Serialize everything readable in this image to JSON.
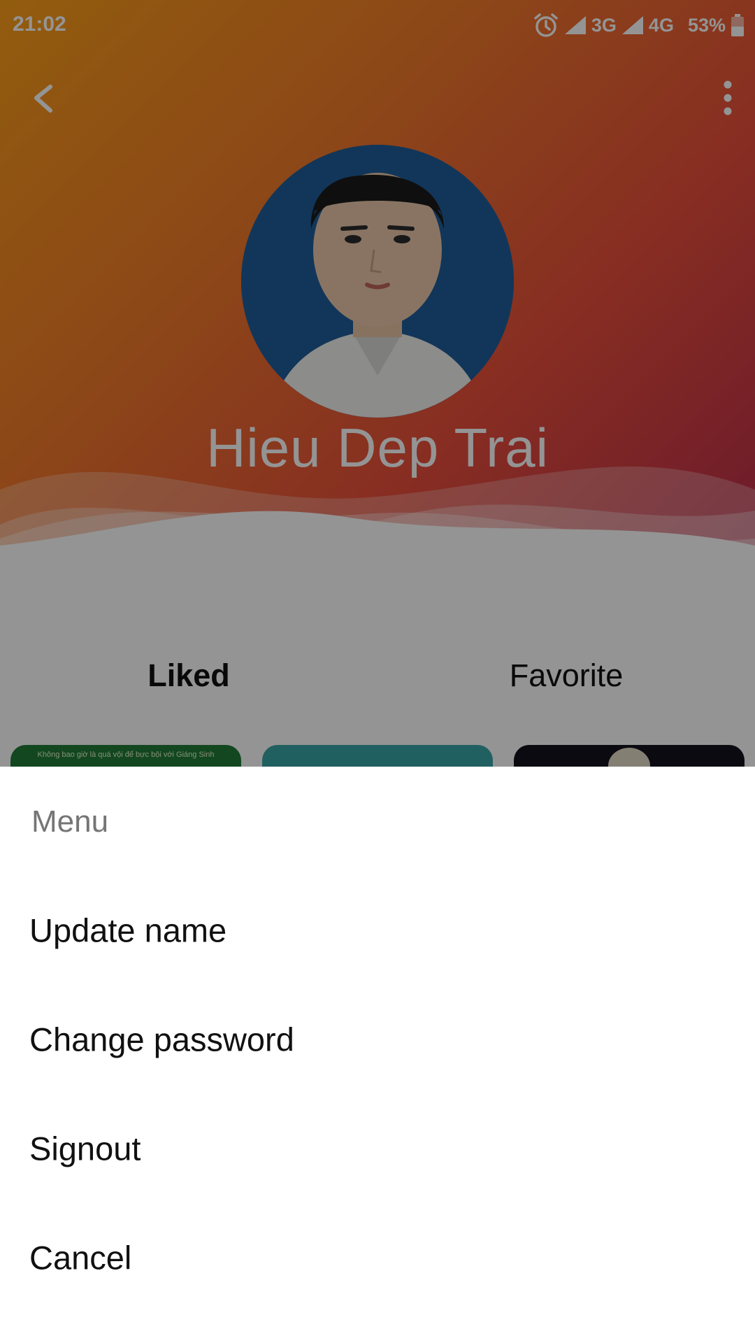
{
  "status_bar": {
    "time": "21:02",
    "network_1": "3G",
    "network_2": "4G",
    "battery": "53%",
    "icons": [
      "alarm-icon",
      "signal-icon",
      "signal-icon",
      "battery-icon"
    ]
  },
  "toolbar": {
    "back_icon": "chevron-left-icon",
    "more_icon": "more-vert-icon"
  },
  "profile": {
    "name": "Hieu Dep Trai"
  },
  "tabs": [
    {
      "label": "Liked",
      "selected": true
    },
    {
      "label": "Favorite",
      "selected": false
    }
  ],
  "thumbnails": {
    "first_caption": "Không bao giờ là quá vội để bực bội với Giáng Sinh"
  },
  "menu": {
    "title": "Menu",
    "items": [
      {
        "label": "Update name"
      },
      {
        "label": "Change password"
      },
      {
        "label": "Signout"
      },
      {
        "label": "Cancel"
      }
    ]
  },
  "colors": {
    "gradient_start": "#fca019",
    "gradient_end": "#b52a4f",
    "scrim": "rgba(0,0,0,0.42)",
    "menu_title": "#757575"
  }
}
